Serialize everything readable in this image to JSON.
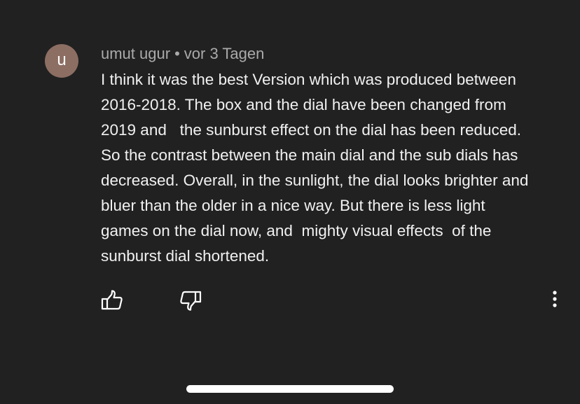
{
  "comment": {
    "avatar_letter": "u",
    "author": "umut ugur",
    "separator": "•",
    "timestamp": "vor 3 Tagen",
    "text_lines": [
      "I think it was the best Version which was produced between",
      "2016-2018. The box and the dial have been changed from",
      "2019 and   the sunburst effect on the dial has been reduced.",
      "So the contrast between the main dial and the sub dials has",
      "decreased. Overall, in the sunlight, the dial looks brighter and",
      "bluer than the older in a nice way. But there is less light",
      "games on the dial now, and  mighty visual effects  of the",
      "sunburst dial shortened."
    ]
  },
  "actions": {
    "like_icon": "thumbs-up-icon",
    "dislike_icon": "thumbs-down-icon",
    "more_icon": "more-vertical-icon"
  },
  "colors": {
    "background": "#212121",
    "avatar": "#8d6e63",
    "meta_text": "#aaaaaa",
    "body_text": "#f1f1f1"
  }
}
